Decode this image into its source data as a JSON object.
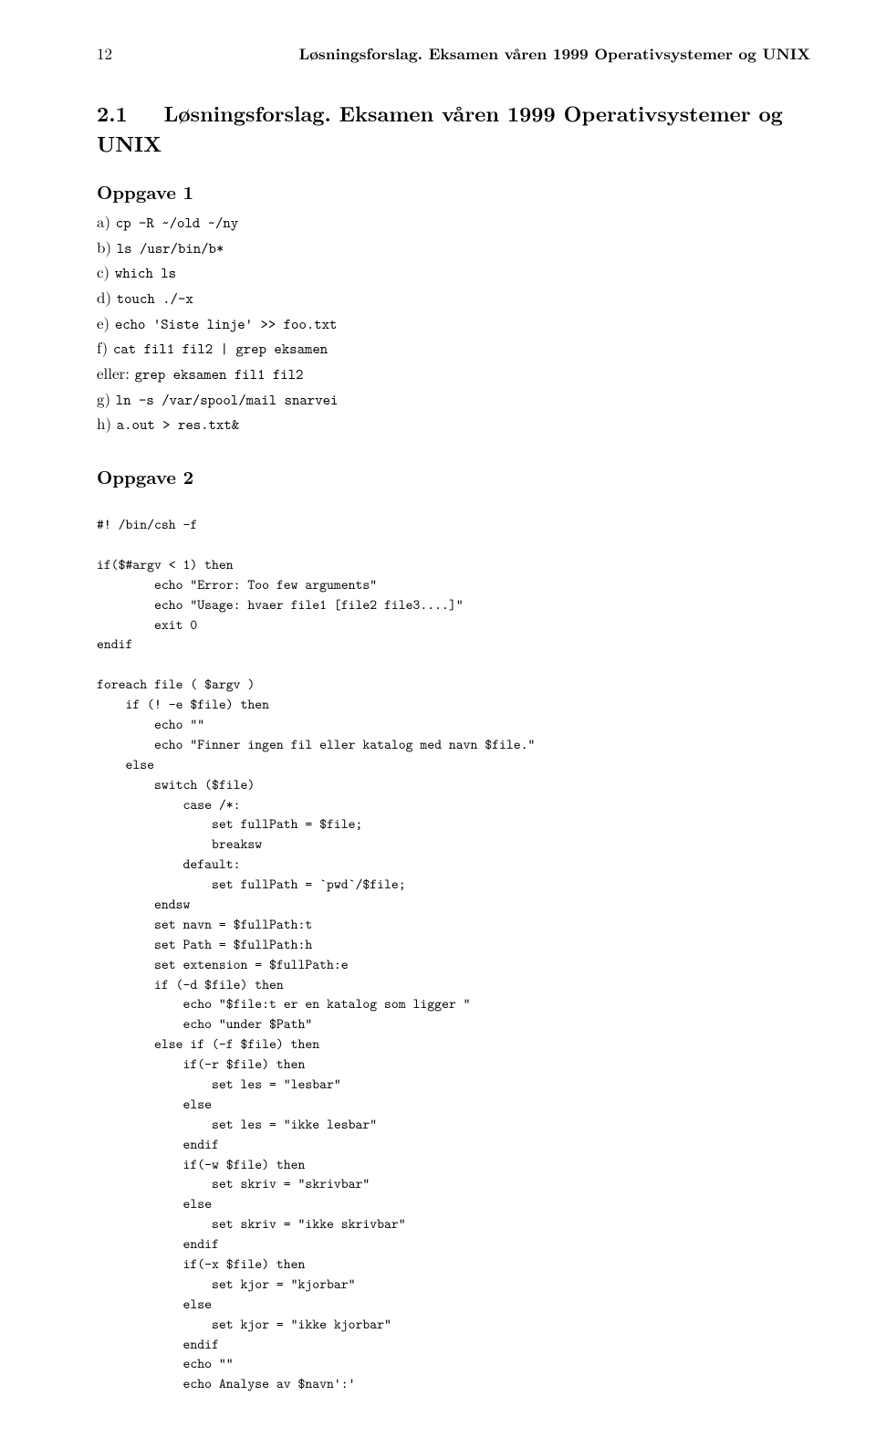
{
  "header": {
    "page_number": "12",
    "running_title": "Løsningsforslag. Eksamen våren 1999 Operativsystemer og UNIX"
  },
  "section": {
    "number": "2.1",
    "title": "Løsningsforslag. Eksamen våren 1999 Operativsystemer og UNIX"
  },
  "oppgave1": {
    "title": "Oppgave 1",
    "items": [
      {
        "label": "a)",
        "code": "cp -R ~/old ~/ny"
      },
      {
        "label": "b)",
        "code": "ls /usr/bin/b*"
      },
      {
        "label": "c)",
        "code": "which ls"
      },
      {
        "label": "d)",
        "code": "touch ./-x"
      },
      {
        "label": "e)",
        "code": "echo 'Siste linje' >> foo.txt"
      },
      {
        "label": "f)",
        "code": "cat fil1 fil2 | grep eksamen"
      },
      {
        "label": "eller:",
        "code": "grep eksamen fil1 fil2"
      },
      {
        "label": "g)",
        "code": "ln -s /var/spool/mail snarvei"
      },
      {
        "label": "h)",
        "code": "a.out > res.txt&"
      }
    ]
  },
  "oppgave2": {
    "title": "Oppgave 2",
    "code": "#! /bin/csh -f\n\nif($#argv < 1) then\n        echo \"Error: Too few arguments\"\n        echo \"Usage: hvaer file1 [file2 file3....]\"\n        exit 0\nendif\n\nforeach file ( $argv )\n    if (! -e $file) then\n        echo \"\"\n        echo \"Finner ingen fil eller katalog med navn $file.\"\n    else\n        switch ($file)\n            case /*:\n                set fullPath = $file;\n                breaksw\n            default:\n                set fullPath = `pwd`/$file;\n        endsw\n        set navn = $fullPath:t\n        set Path = $fullPath:h\n        set extension = $fullPath:e\n        if (-d $file) then\n            echo \"$file:t er en katalog som ligger \"\n            echo \"under $Path\"\n        else if (-f $file) then\n            if(-r $file) then\n                set les = \"lesbar\"\n            else\n                set les = \"ikke lesbar\"\n            endif\n            if(-w $file) then\n                set skriv = \"skrivbar\"\n            else\n                set skriv = \"ikke skrivbar\"\n            endif\n            if(-x $file) then\n                set kjor = \"kjorbar\"\n            else\n                set kjor = \"ikke kjorbar\"\n            endif\n            echo \"\"\n            echo Analyse av $navn':'"
  }
}
